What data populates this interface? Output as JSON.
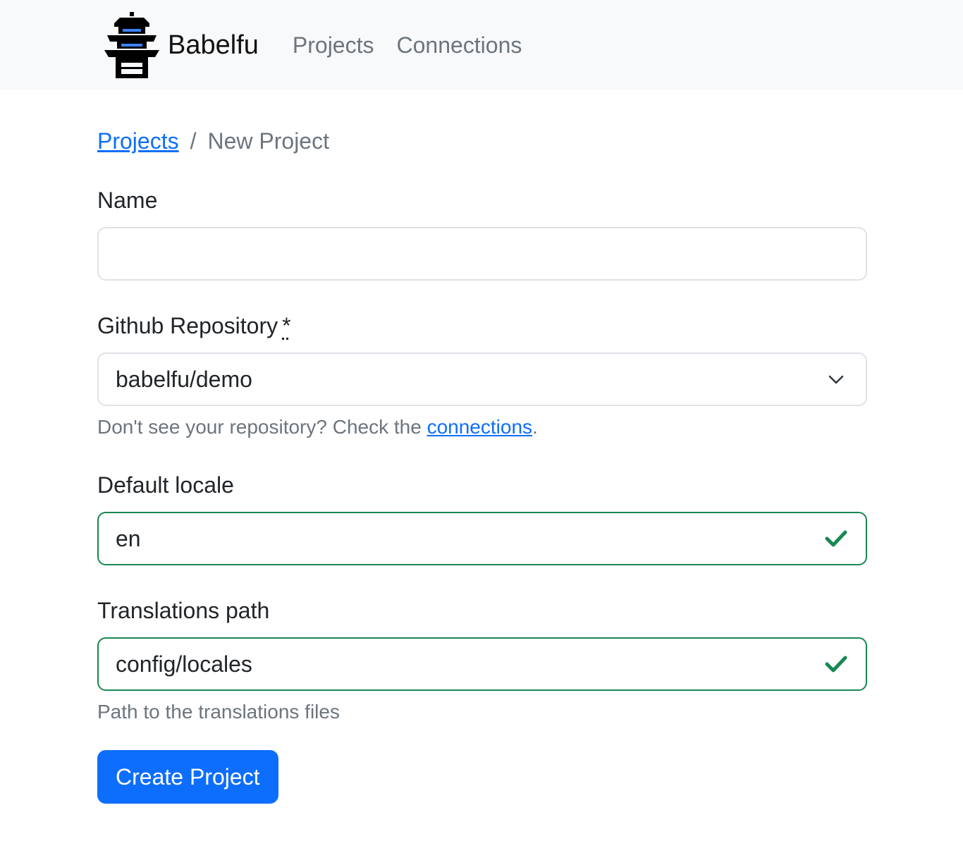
{
  "navbar": {
    "brand_name": "Babelfu",
    "links": [
      {
        "label": "Projects"
      },
      {
        "label": "Connections"
      }
    ]
  },
  "breadcrumb": {
    "parent": "Projects",
    "separator": "/",
    "current": "New Project"
  },
  "form": {
    "name": {
      "label": "Name",
      "value": ""
    },
    "repository": {
      "label": "Github Repository",
      "required_marker": "*",
      "selected": "babelfu/demo",
      "help_prefix": "Don't see your repository? Check the ",
      "help_link": "connections",
      "help_suffix": "."
    },
    "default_locale": {
      "label": "Default locale",
      "value": "en"
    },
    "translations_path": {
      "label": "Translations path",
      "value": "config/locales",
      "help": "Path to the translations files"
    },
    "submit_label": "Create Project"
  },
  "colors": {
    "primary": "#0d6efd",
    "success": "#198754",
    "muted": "#6c757d",
    "navbar_bg": "#f8f9fa",
    "logo_accent": "#3b82f6"
  },
  "icons": {
    "brand": "pagoda-logo-icon",
    "select": "chevron-down-icon",
    "valid": "check-icon"
  }
}
